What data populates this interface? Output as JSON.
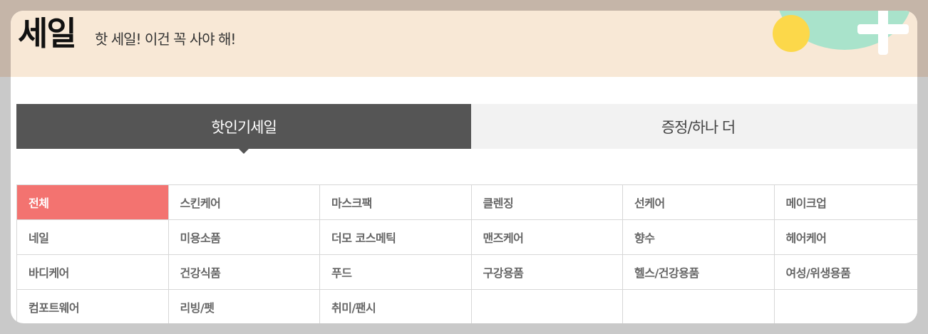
{
  "header": {
    "title": "세일",
    "subtitle": "핫 세일! 이건 꼭 사야 해!"
  },
  "tabs": [
    {
      "label": "핫인기세일",
      "active": true
    },
    {
      "label": "증정/하나 더",
      "active": false
    }
  ],
  "categories": {
    "rows": [
      [
        "전체",
        "스킨케어",
        "마스크팩",
        "클렌징",
        "선케어",
        "메이크업"
      ],
      [
        "네일",
        "미용소품",
        "더모 코스메틱",
        "맨즈케어",
        "향수",
        "헤어케어"
      ],
      [
        "바디케어",
        "건강식품",
        "푸드",
        "구강용품",
        "헬스/건강용품",
        "여성/위생용품"
      ],
      [
        "컴포트웨어",
        "리빙/펫",
        "취미/팬시",
        "",
        "",
        ""
      ]
    ],
    "active": "전체"
  },
  "colors": {
    "active_category": "#f37370",
    "active_tab": "#555555",
    "header_bg": "#f8e8d6",
    "deco_green": "#a9e3cb",
    "deco_yellow": "#fcd84a"
  }
}
